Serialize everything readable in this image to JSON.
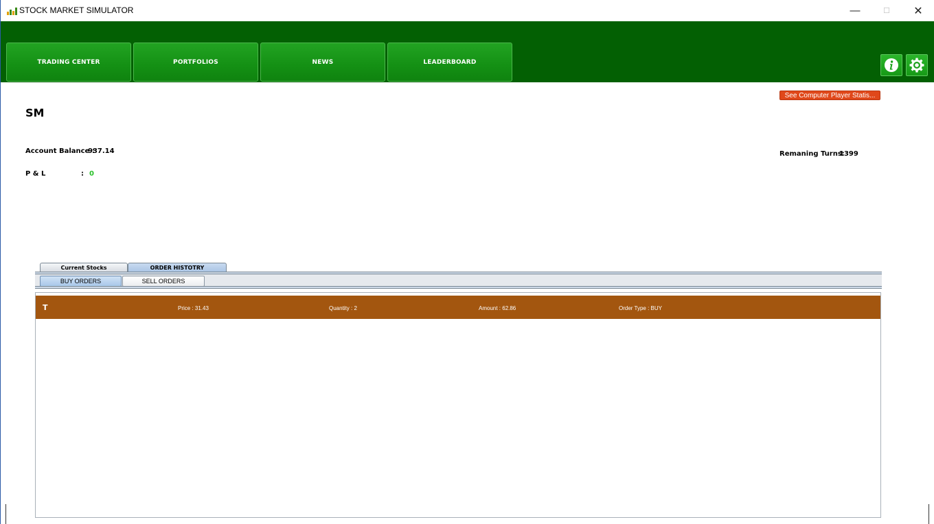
{
  "window": {
    "title": "STOCK MARKET SIMULATOR",
    "min_glyph": "—",
    "max_glyph": "☐",
    "close_glyph": "✕"
  },
  "nav": {
    "items": [
      {
        "label": "TRADING CENTER"
      },
      {
        "label": "PORTFOLIOS"
      },
      {
        "label": "NEWS"
      },
      {
        "label": "LEADERBOARD"
      }
    ],
    "info_icon": "info-icon",
    "settings_icon": "gear-icon"
  },
  "player": {
    "stats_button": "See Computer Player Statis...",
    "name": "SM",
    "account_balance_label": "Account Balance :",
    "account_balance": "937.14",
    "pl_label": "P & L",
    "pl_colon": ":",
    "pl_value": "0",
    "turns_label": "Remaning Turns:",
    "turns_value": "1399"
  },
  "tabs": {
    "main": [
      {
        "label": "Current Stocks"
      },
      {
        "label": "ORDER HISTOTRY"
      }
    ],
    "selected": "ORDER HISTOTRY",
    "sub": [
      {
        "label": "BUY ORDERS"
      },
      {
        "label": "SELL ORDERS"
      }
    ],
    "sub_selected": "BUY ORDERS"
  },
  "orders": [
    {
      "symbol": "T",
      "price": "Price : 31.43",
      "quantity": "Quantity : 2",
      "amount": "Amount : 62.86",
      "type": "Order Type : BUY"
    }
  ],
  "colors": {
    "header_green": "#036003",
    "nav_green": "#149014",
    "stats_orange": "#e0481a",
    "order_row_brown": "#a3560f",
    "pl_green": "#28c028"
  }
}
